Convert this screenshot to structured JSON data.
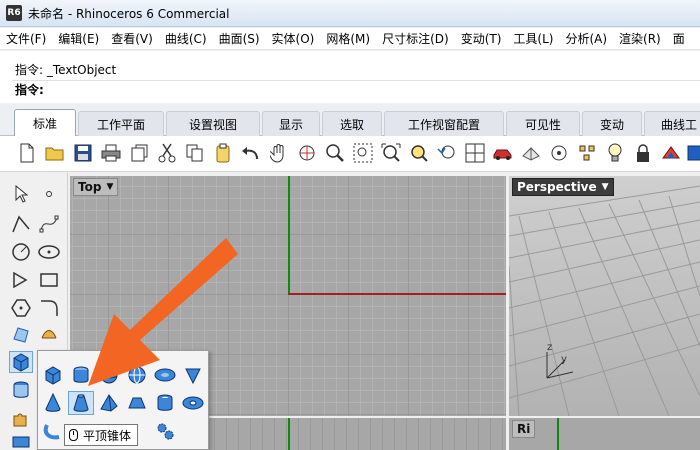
{
  "window": {
    "title": "未命名 - Rhinoceros 6 Commercial",
    "app_icon_text": "R6"
  },
  "menu": [
    {
      "label": "文件(F)"
    },
    {
      "label": "编辑(E)"
    },
    {
      "label": "查看(V)"
    },
    {
      "label": "曲线(C)"
    },
    {
      "label": "曲面(S)"
    },
    {
      "label": "实体(O)"
    },
    {
      "label": "网格(M)"
    },
    {
      "label": "尺寸标注(D)"
    },
    {
      "label": "变动(T)"
    },
    {
      "label": "工具(L)"
    },
    {
      "label": "分析(A)"
    },
    {
      "label": "渲染(R)"
    },
    {
      "label": "面"
    }
  ],
  "command": {
    "history": "指令: _TextObject",
    "prompt": "指令:"
  },
  "tabs": [
    {
      "label": "标准",
      "active": true
    },
    {
      "label": "工作平面"
    },
    {
      "label": "设置视图"
    },
    {
      "label": "显示"
    },
    {
      "label": "选取"
    },
    {
      "label": "工作视窗配置"
    },
    {
      "label": "可见性"
    },
    {
      "label": "变动"
    },
    {
      "label": "曲线工"
    }
  ],
  "viewports": {
    "top": {
      "label": "Top"
    },
    "perspective": {
      "label": "Perspective"
    },
    "right": {
      "label": "Ri"
    }
  },
  "tooltip": {
    "text": "平顶锥体"
  },
  "axis_labels": {
    "y": "y",
    "z": "z"
  },
  "colors": {
    "x_axis": "#a42020",
    "y_axis": "#0c8a0c",
    "arrow": "#f26522",
    "accent": "#1f5fbf"
  }
}
